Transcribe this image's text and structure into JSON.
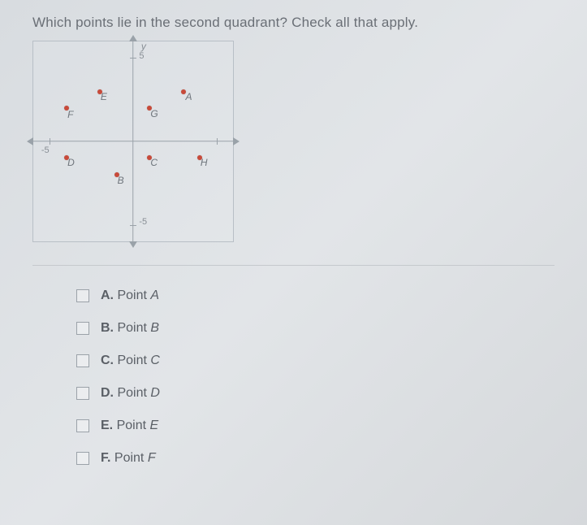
{
  "question": "Which points lie in the second quadrant? Check all that apply.",
  "chart_data": {
    "type": "scatter",
    "xlim": [
      -6,
      6
    ],
    "ylim": [
      -6,
      6
    ],
    "xlabel": "",
    "ylabel": "y",
    "ticks": {
      "y_labels": [
        "5",
        "-5"
      ],
      "x_label_neg": "-5"
    },
    "points": [
      {
        "name": "A",
        "x": 3,
        "y": 3
      },
      {
        "name": "B",
        "x": -1,
        "y": -2
      },
      {
        "name": "C",
        "x": 1,
        "y": -1
      },
      {
        "name": "D",
        "x": -4,
        "y": -1
      },
      {
        "name": "E",
        "x": -2,
        "y": 3
      },
      {
        "name": "F",
        "x": -4,
        "y": 2
      },
      {
        "name": "G",
        "x": 1,
        "y": 2
      },
      {
        "name": "H",
        "x": 4,
        "y": -1
      }
    ]
  },
  "options": [
    {
      "letter": "A.",
      "label": "Point",
      "point": "A"
    },
    {
      "letter": "B.",
      "label": "Point",
      "point": "B"
    },
    {
      "letter": "C.",
      "label": "Point",
      "point": "C"
    },
    {
      "letter": "D.",
      "label": "Point",
      "point": "D"
    },
    {
      "letter": "E.",
      "label": "Point",
      "point": "E"
    },
    {
      "letter": "F.",
      "label": "Point",
      "point": "F"
    }
  ]
}
